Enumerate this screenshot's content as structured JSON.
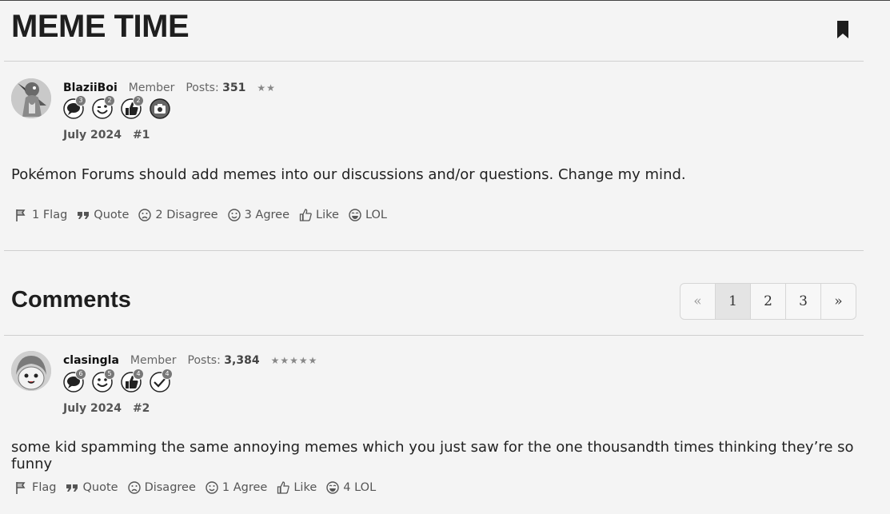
{
  "thread": {
    "title": "MEME TIME"
  },
  "post1": {
    "username": "BlaziiBoi",
    "role": "Member",
    "posts_label": "Posts:",
    "posts_count": "351",
    "stars": "★★",
    "badges": [
      {
        "icon": "speech-bubble-icon",
        "count": "3"
      },
      {
        "icon": "winking-face-icon",
        "count": "2"
      },
      {
        "icon": "thumbs-up-icon",
        "count": "2"
      },
      {
        "icon": "camera-icon",
        "count": ""
      }
    ],
    "date": "July 2024",
    "number": "#1",
    "text": "Pokémon Forums should add memes into our discussions and/or questions. Change my mind.",
    "actions": {
      "flag": "1 Flag",
      "quote": "Quote",
      "disagree": "2 Disagree",
      "agree": "3 Agree",
      "like": "Like",
      "lol": "LOL"
    }
  },
  "comments": {
    "title": "Comments",
    "pagination": {
      "prev": "«",
      "pages": [
        "1",
        "2",
        "3"
      ],
      "current": "1",
      "next": "»"
    }
  },
  "post2": {
    "username": "clasingla",
    "role": "Member",
    "posts_label": "Posts:",
    "posts_count": "3,384",
    "stars": "★★★★★",
    "badges": [
      {
        "icon": "speech-bubble-icon",
        "count": "6"
      },
      {
        "icon": "smiley-face-icon",
        "count": "5"
      },
      {
        "icon": "thumbs-up-icon",
        "count": "4"
      },
      {
        "icon": "checkmark-icon",
        "count": "4"
      }
    ],
    "date": "July 2024",
    "number": "#2",
    "text": "some kid spamming the same annoying memes which you just saw for the one thousandth times thinking they’re so funny",
    "actions": {
      "flag": "Flag",
      "quote": "Quote",
      "disagree": "Disagree",
      "agree": "1 Agree",
      "like": "Like",
      "lol": "4 LOL"
    }
  }
}
